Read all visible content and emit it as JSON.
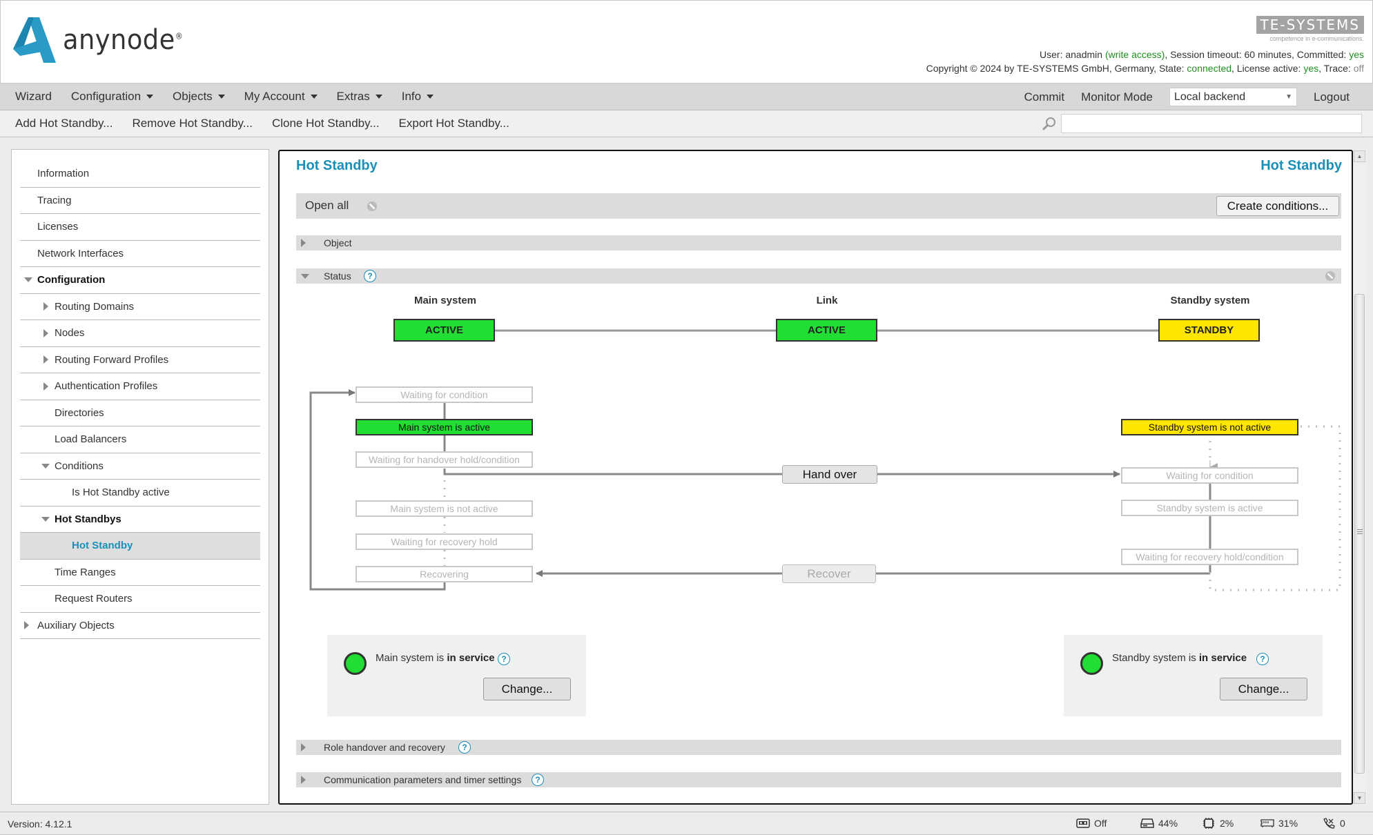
{
  "header": {
    "logo_text": "anynode",
    "logo_reg": "®",
    "brand": "TE-SYSTEMS",
    "brand_tagline": "competence in e-communications.",
    "user_prefix": "User: ",
    "user": "anadmin",
    "access": "(write access)",
    "session": ", Session timeout: 60 minutes, Committed: ",
    "committed": "yes",
    "copyright": "Copyright © 2024 by TE-SYSTEMS GmbH, Germany, State: ",
    "state": "connected",
    "license_prefix": ", License active: ",
    "license": "yes",
    "trace_prefix": ", Trace: ",
    "trace": "off"
  },
  "menubar": {
    "items": [
      {
        "label": "Wizard",
        "dropdown": false
      },
      {
        "label": "Configuration",
        "dropdown": true
      },
      {
        "label": "Objects",
        "dropdown": true
      },
      {
        "label": "My Account",
        "dropdown": true
      },
      {
        "label": "Extras",
        "dropdown": true
      },
      {
        "label": "Info",
        "dropdown": true
      }
    ],
    "commit": "Commit",
    "monitor_mode": "Monitor Mode",
    "backend": "Local backend",
    "logout": "Logout"
  },
  "toolbar": {
    "add": "Add Hot Standby...",
    "remove": "Remove Hot Standby...",
    "clone": "Clone Hot Standby...",
    "export": "Export Hot Standby...",
    "search_value": ""
  },
  "sidebar": {
    "items": [
      {
        "label": "Information",
        "level": 0,
        "expander": "none"
      },
      {
        "label": "Tracing",
        "level": 0,
        "expander": "none"
      },
      {
        "label": "Licenses",
        "level": 0,
        "expander": "none"
      },
      {
        "label": "Network Interfaces",
        "level": 0,
        "expander": "none"
      },
      {
        "label": "Configuration",
        "level": 0,
        "expander": "open",
        "bold": true
      },
      {
        "label": "Routing Domains",
        "level": 1,
        "expander": "closed"
      },
      {
        "label": "Nodes",
        "level": 1,
        "expander": "closed"
      },
      {
        "label": "Routing Forward Profiles",
        "level": 1,
        "expander": "closed"
      },
      {
        "label": "Authentication Profiles",
        "level": 1,
        "expander": "closed"
      },
      {
        "label": "Directories",
        "level": 1,
        "expander": "none"
      },
      {
        "label": "Load Balancers",
        "level": 1,
        "expander": "none"
      },
      {
        "label": "Conditions",
        "level": 1,
        "expander": "open"
      },
      {
        "label": "Is Hot Standby active",
        "level": 2,
        "expander": "none"
      },
      {
        "label": "Hot Standbys",
        "level": 1,
        "expander": "open",
        "bold": true
      },
      {
        "label": "Hot Standby",
        "level": 2,
        "expander": "none",
        "selected": true
      },
      {
        "label": "Time Ranges",
        "level": 1,
        "expander": "none"
      },
      {
        "label": "Request Routers",
        "level": 1,
        "expander": "none"
      },
      {
        "label": "Auxiliary Objects",
        "level": 0,
        "expander": "closed"
      }
    ]
  },
  "main": {
    "title": "Hot Standby",
    "title_right": "Hot Standby",
    "open_all": "Open all",
    "create_conditions": "Create conditions...",
    "sections": {
      "object": "Object",
      "status": "Status",
      "role_handover": "Role handover and recovery",
      "comm_params": "Communication parameters and timer settings"
    },
    "help_glyph": "?",
    "status": {
      "main_head": "Main system",
      "link_head": "Link",
      "standby_head": "Standby system",
      "main_state": "ACTIVE",
      "link_state": "ACTIVE",
      "standby_state": "STANDBY",
      "main_steps": [
        {
          "label": "Waiting for condition",
          "active": false
        },
        {
          "label": "Main system is active",
          "active": true
        },
        {
          "label": "Waiting for handover hold/condition",
          "active": false
        },
        {
          "label": "Main system is not active",
          "active": false
        },
        {
          "label": "Waiting for recovery hold",
          "active": false
        },
        {
          "label": "Recovering",
          "active": false
        }
      ],
      "standby_steps": [
        {
          "label": "Standby system is not active",
          "active": true
        },
        {
          "label": "Waiting for condition",
          "active": false
        },
        {
          "label": "Standby system is active",
          "active": false
        },
        {
          "label": "Waiting for recovery hold/condition",
          "active": false
        }
      ],
      "hand_over": "Hand over",
      "recover": "Recover",
      "main_service": {
        "prefix": "Main system is ",
        "state": "in service",
        "button": "Change..."
      },
      "standby_service": {
        "prefix": "Standby system is ",
        "state": "in service",
        "button": "Change..."
      }
    },
    "colors": {
      "active": "#22dd33",
      "standby": "#ffe600",
      "accent": "#1a8fb8"
    }
  },
  "statusbar": {
    "version_label": "Version:",
    "version": "4.12.1",
    "recording": "Off",
    "disk": "44%",
    "cpu": "2%",
    "memory": "31%",
    "calls": "0"
  }
}
